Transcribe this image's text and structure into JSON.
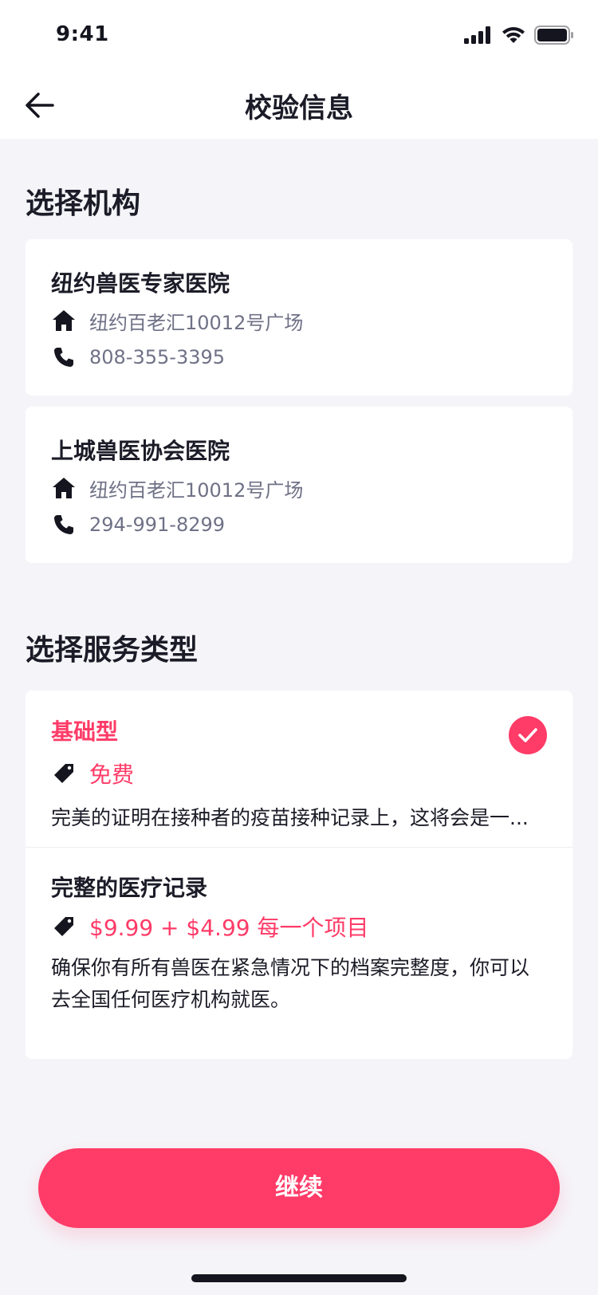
{
  "status_bar": {
    "time": "9:41",
    "icons": [
      "signal-icon",
      "wifi-icon",
      "battery-icon"
    ]
  },
  "nav": {
    "title": "校验信息",
    "back_icon": "arrow-left-icon"
  },
  "sections": {
    "institution_title": "选择机构",
    "service_title": "选择服务类型"
  },
  "clinics": [
    {
      "name": "纽约兽医专家医院",
      "address": "纽约百老汇10012号广场",
      "phone": "808-355-3395"
    },
    {
      "name": "上城兽医协会医院",
      "address": "纽约百老汇10012号广场",
      "phone": "294-991-8299"
    }
  ],
  "services": [
    {
      "title": "基础型",
      "price": "免费",
      "description": "完美的证明在接种者的疫苗接种记录上，这将会是一...",
      "selected": true
    },
    {
      "title": "完整的医疗记录",
      "price": "$9.99 + $4.99 每一个项目",
      "description": "确保你有所有兽医在紧急情况下的档案完整度，你可以去全国任何医疗机构就医。",
      "selected": false
    }
  ],
  "cta": {
    "label": "继续"
  },
  "colors": {
    "accent": "#ff3b67",
    "background": "#f5f5f9",
    "text": "#1c1c28",
    "muted": "#6f7186"
  }
}
